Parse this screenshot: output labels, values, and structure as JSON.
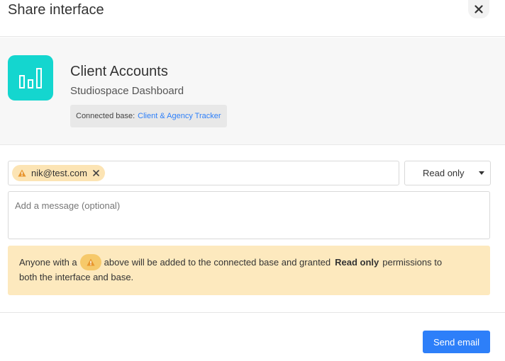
{
  "dialog": {
    "title": "Share interface",
    "close_icon": "close-icon"
  },
  "interface": {
    "icon": "bar-chart-icon",
    "icon_color": "#14d6cf",
    "name": "Client Accounts",
    "subtitle": "Studiospace Dashboard",
    "connected_base_label": "Connected base:",
    "connected_base_name": "Client & Agency Tracker"
  },
  "share": {
    "recipients": [
      {
        "email": "nik@test.com",
        "status_icon": "warning-icon"
      }
    ],
    "permission": "Read only",
    "message_placeholder": "Add a message (optional)"
  },
  "banner": {
    "text_before": "Anyone with a",
    "text_middle": "above will be added to the connected base and granted",
    "permission_bold": "Read only",
    "text_after": "permissions to",
    "text_line2": "both the interface and base.",
    "background": "#fde9be"
  },
  "footer": {
    "send_label": "Send email",
    "accent": "#2d7ff9"
  }
}
